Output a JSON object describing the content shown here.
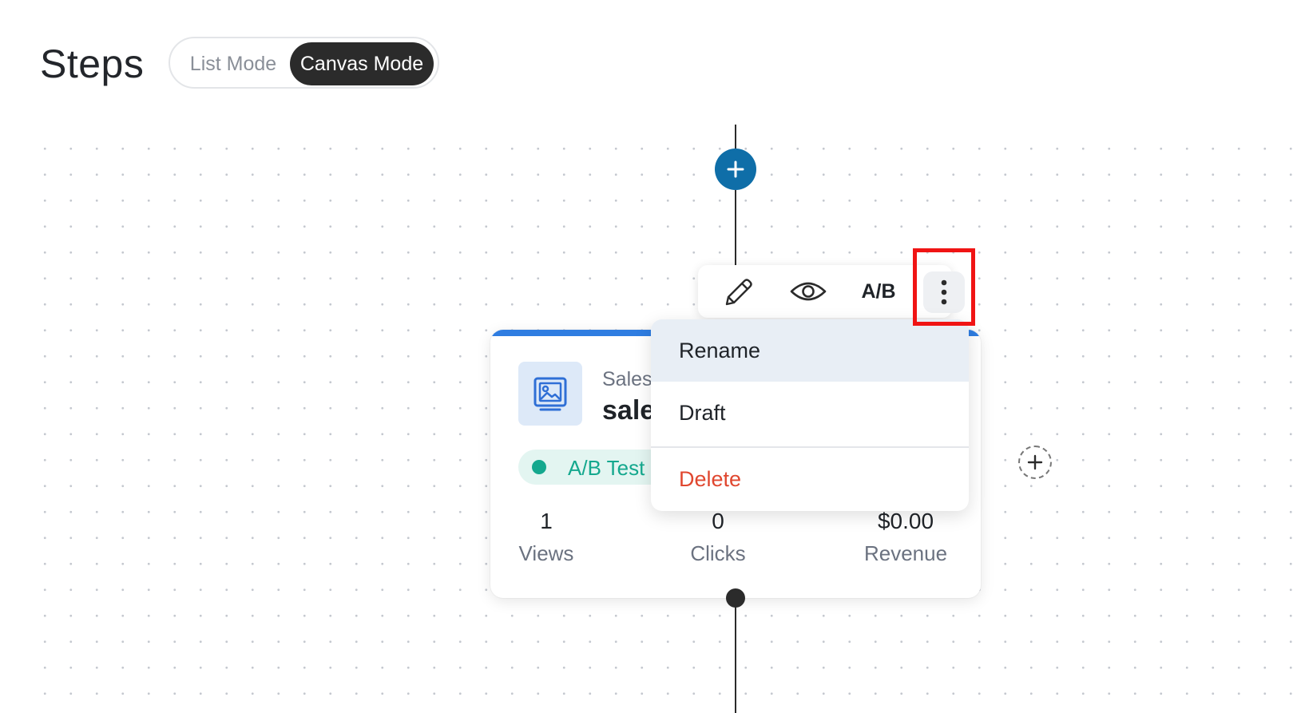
{
  "header": {
    "title": "Steps",
    "modes": [
      {
        "label": "List Mode",
        "active": false
      },
      {
        "label": "Canvas Mode",
        "active": true
      }
    ]
  },
  "canvas": {
    "add_button_icon": "plus-icon",
    "side_add_button_icon": "plus-icon"
  },
  "toolbar": {
    "edit_icon": "pencil-icon",
    "preview_icon": "eye-icon",
    "ab_label": "A/B",
    "more_icon": "kebab-menu-icon"
  },
  "menu": {
    "items": [
      {
        "label": "Rename",
        "highlighted": true
      },
      {
        "label": "Draft"
      },
      {
        "label": "Delete",
        "danger": true
      }
    ]
  },
  "step": {
    "type": "Sales",
    "name": "sale",
    "badge": "A/B Test",
    "icon": "image-icon",
    "stats": [
      {
        "value": "1",
        "label": "Views"
      },
      {
        "value": "0",
        "label": "Clicks"
      },
      {
        "value": "$0.00",
        "label": "Revenue"
      }
    ]
  },
  "colors": {
    "primary": "#0f6ea8",
    "card_accent": "#2f7de1",
    "badge": "#14a88e",
    "danger": "#e0472f",
    "highlight": "#f01414"
  }
}
